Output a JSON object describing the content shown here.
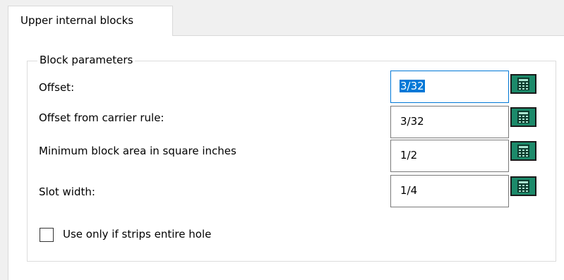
{
  "tabs": [
    {
      "label": "Upper internal blocks",
      "active": true
    }
  ],
  "group": {
    "title": "Block parameters"
  },
  "fields": [
    {
      "label": "Offset:",
      "value": "3/32",
      "focused": true
    },
    {
      "label": "Offset from carrier rule:",
      "value": "3/32",
      "focused": false
    },
    {
      "label": "Minimum block area in square inches",
      "value": "1/2",
      "focused": false
    },
    {
      "label": "Slot width:",
      "value": "1/4",
      "focused": false
    }
  ],
  "checkbox": {
    "label": "Use only if strips entire hole",
    "checked": false
  },
  "icons": {
    "calculator": "calculator-icon"
  },
  "colors": {
    "selection": "#0078d7",
    "calculator": "#1c8a6a",
    "panel_bg": "#ffffff",
    "window_bg": "#f0f0f0"
  }
}
